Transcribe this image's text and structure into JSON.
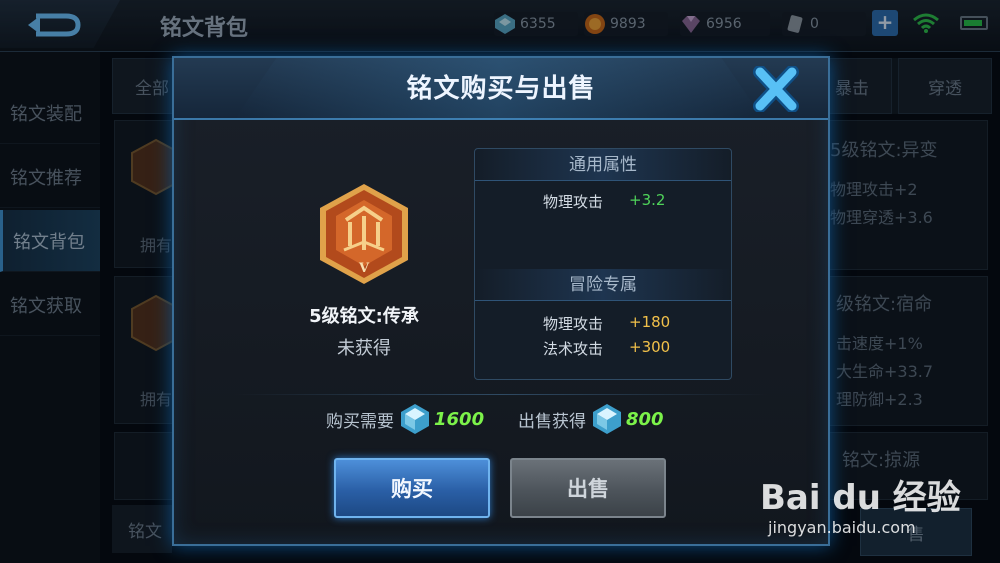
{
  "topbar": {
    "title": "铭文背包",
    "resources": [
      {
        "icon": "crystal-icon",
        "value": "6355"
      },
      {
        "icon": "gold-coin-icon",
        "value": "9893"
      },
      {
        "icon": "gem-fragment-icon",
        "value": "6956"
      },
      {
        "icon": "scroll-icon",
        "value": "0"
      }
    ],
    "plus": "+"
  },
  "sidebar": {
    "items": [
      {
        "label": "铭文装配"
      },
      {
        "label": "铭文推荐"
      },
      {
        "label": "铭文背包",
        "active": true
      },
      {
        "label": "铭文获取"
      }
    ]
  },
  "background": {
    "tabs": [
      "全部",
      "暴击",
      "穿透"
    ],
    "cards": [
      {
        "owned": "拥有"
      },
      {
        "owned": "拥有"
      },
      {
        "owned": ""
      }
    ],
    "right_cards": [
      {
        "name": "5级铭文:异变",
        "attrs": [
          "物理攻击+2",
          "物理穿透+3.6"
        ]
      },
      {
        "name": "级铭文:宿命",
        "attrs": [
          "击速度+1%",
          "大生命+33.7",
          "理防御+2.3"
        ]
      },
      {
        "name": "铭文:掠源",
        "attrs": []
      }
    ],
    "bottom_left": "铭文",
    "bottom_right": "售"
  },
  "modal": {
    "title": "铭文购买与出售",
    "item": {
      "name": "5级铭文:传承",
      "status": "未获得",
      "level_mark": "V"
    },
    "common": {
      "header": "通用属性",
      "rows": [
        {
          "key": "物理攻击",
          "value": "+3.2"
        }
      ]
    },
    "adventure": {
      "header": "冒险专属",
      "rows": [
        {
          "key": "物理攻击",
          "value": "+180"
        },
        {
          "key": "法术攻击",
          "value": "+300"
        }
      ]
    },
    "buy_price": {
      "label": "购买需要",
      "value": "1600"
    },
    "sell_price": {
      "label": "出售获得",
      "value": "800"
    },
    "buy_button": "购买",
    "sell_button": "出售"
  },
  "watermark": {
    "logo": "Bai du 经验",
    "url": "jingyan.baidu.com"
  },
  "colors": {
    "accent": "#3b78a8",
    "positive": "#4fd35a",
    "gold": "#f1c04a",
    "price": "#7cf24a"
  }
}
